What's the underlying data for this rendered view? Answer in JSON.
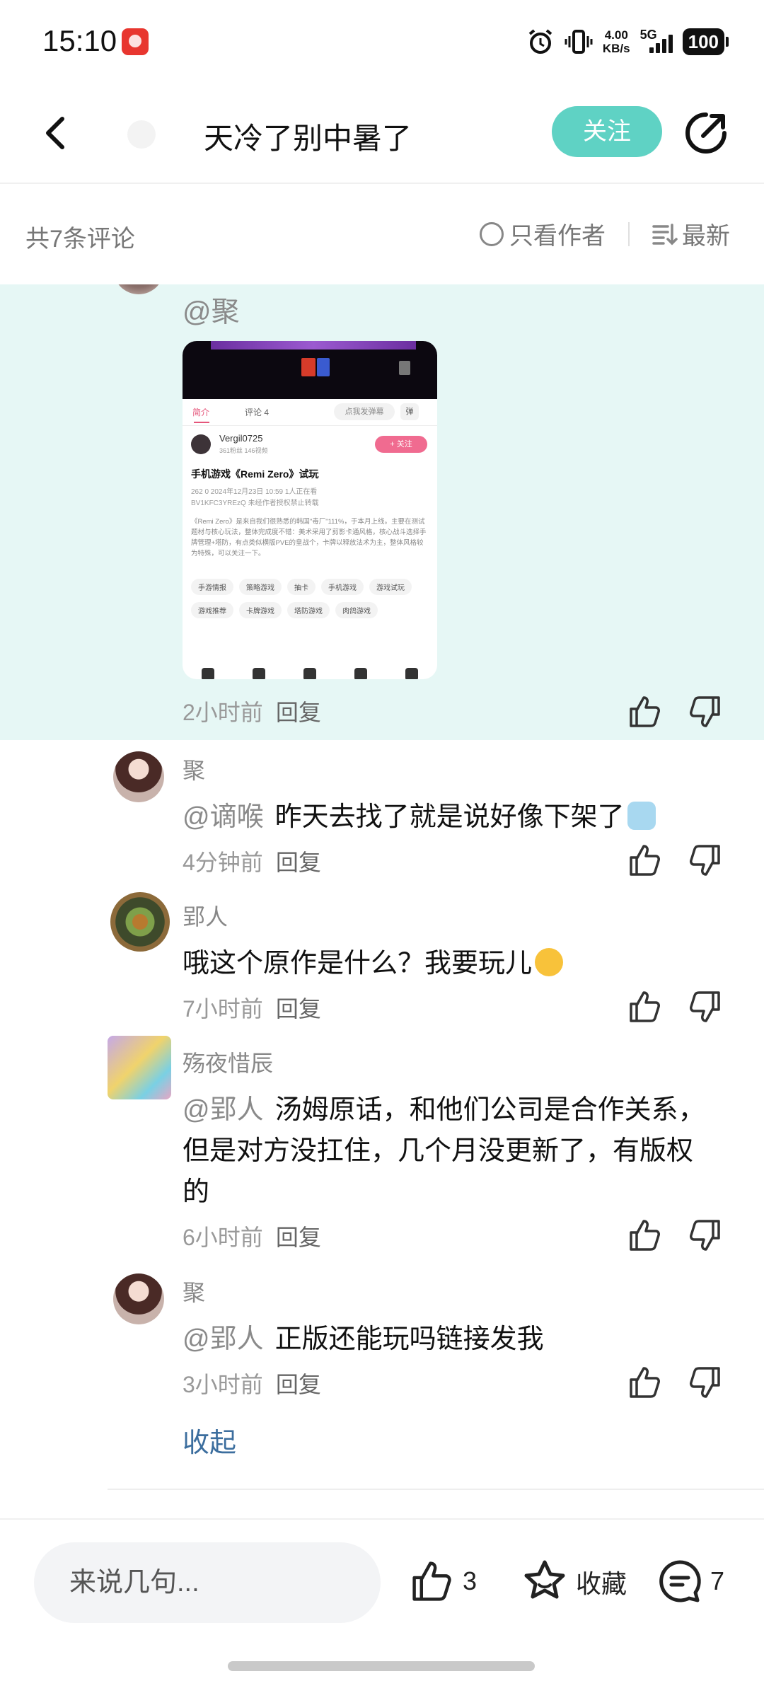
{
  "status_bar": {
    "time": "15:10",
    "speed_value": "4.00",
    "speed_unit": "KB/s",
    "network": "5G",
    "battery": "100"
  },
  "nav": {
    "title": "天冷了别中暑了",
    "follow_label": "关注"
  },
  "comments_header": {
    "count_label": "共7条评论",
    "author_only_label": "只看作者",
    "sort_label": "最新"
  },
  "highlighted_reply": {
    "mention": "@聚",
    "meta_time": "2小时前",
    "reply_label": "回复",
    "screenshot": {
      "tab_intro": "简介",
      "tab_comments": "评论 4",
      "danmu_placeholder": "点我发弹幕",
      "danmu_btn": "弹",
      "uploader": "Vergil0725",
      "uploader_stats": "361粉丝  146视频",
      "follow": "+ 关注",
      "video_title": "手机游戏《Remi Zero》试玩",
      "meta_line": "262  0  2024年12月23日 10:59  1人正在看",
      "bv_line": "BV1KFC3YREzQ  未经作者授权禁止转载",
      "description": "《Remi Zero》是来自我们很熟悉的韩国\"毒厂\"111%，于本月上线。主要在测试题材与核心玩法，整体完成度不错：美术采用了剪影卡通风格，核心战斗选择手牌管理+塔防，有点类似横版PVE的皇战个，卡牌以释放法术为主，整体风格较为特殊，可以关注一下。",
      "tags": [
        "手游情报",
        "策略游戏",
        "抽卡",
        "手机游戏",
        "游戏试玩",
        "游戏推荐",
        "卡牌游戏",
        "塔防游戏",
        "肉鸽游戏"
      ]
    }
  },
  "replies": [
    {
      "name": "聚",
      "mention": "@谪喉",
      "text": "昨天去找了就是说好像下架了",
      "time": "4分钟前",
      "reply_label": "回复"
    },
    {
      "name": "郢人",
      "mention": "",
      "text": "哦这个原作是什么？我要玩儿",
      "time": "7小时前",
      "reply_label": "回复"
    },
    {
      "name": "殇夜惜辰",
      "mention": "@郢人",
      "text": "汤姆原话，和他们公司是合作关系，但是对方没扛住，几个月没更新了，有版权的",
      "time": "6小时前",
      "reply_label": "回复"
    },
    {
      "name": "聚",
      "mention": "@郢人",
      "text": "正版还能玩吗链接发我",
      "time": "3小时前",
      "reply_label": "回复"
    }
  ],
  "collapse_label": "收起",
  "bottom_bar": {
    "input_placeholder": "来说几句...",
    "like_count": "3",
    "favorite_label": "收藏",
    "comment_count": "7"
  },
  "colors": {
    "accent": "#5fd2c4",
    "highlight_bg": "#e6f7f5",
    "link": "#3c6e9e"
  },
  "icons": [
    "back-arrow-icon",
    "share-icon",
    "circle-icon",
    "sort-icon",
    "thumbs-up-icon",
    "thumbs-down-icon",
    "star-icon",
    "comment-bubble-icon",
    "alarm-icon",
    "vibrate-icon"
  ]
}
